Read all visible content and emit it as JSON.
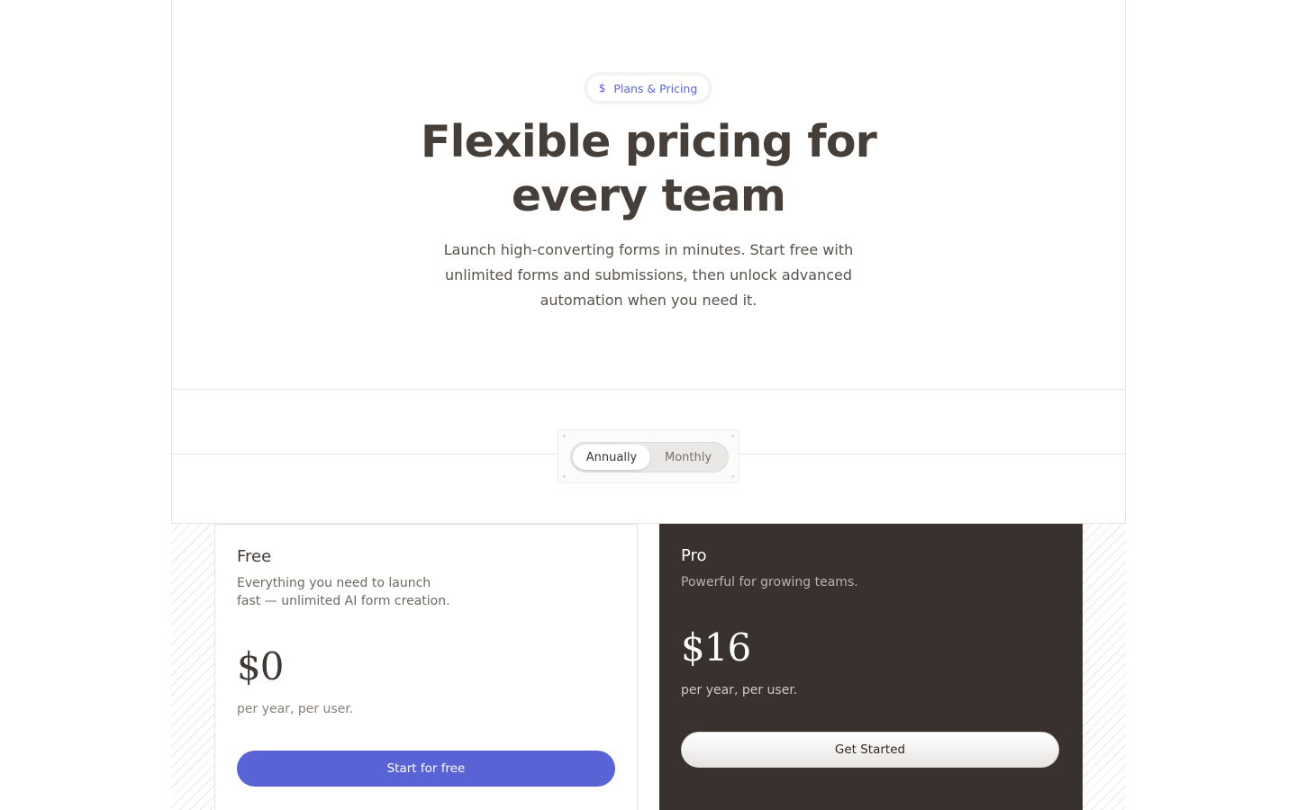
{
  "badge": {
    "icon": "dollar-icon",
    "glyph": "$",
    "label": "Plans & Pricing"
  },
  "hero": {
    "title_line1": "Flexible pricing for",
    "title_line2": "every team",
    "subtitle": "Launch high-converting forms in minutes. Start free with unlimited forms and submissions, then unlock advanced automation when you need it."
  },
  "billing_toggle": {
    "options": [
      "Annually",
      "Monthly"
    ],
    "selected": "Annually"
  },
  "plans": [
    {
      "name": "Free",
      "description": "Everything you need to launch fast — unlimited AI form creation.",
      "price": "$0",
      "period": "per year, per user.",
      "cta": "Start for free"
    },
    {
      "name": "Pro",
      "description": "Powerful for growing teams.",
      "price": "$16",
      "period": "per year, per user.",
      "cta": "Get Started"
    }
  ],
  "colors": {
    "accent": "#5a63d6",
    "dark_card": "#38312e",
    "heading": "#463f39"
  }
}
